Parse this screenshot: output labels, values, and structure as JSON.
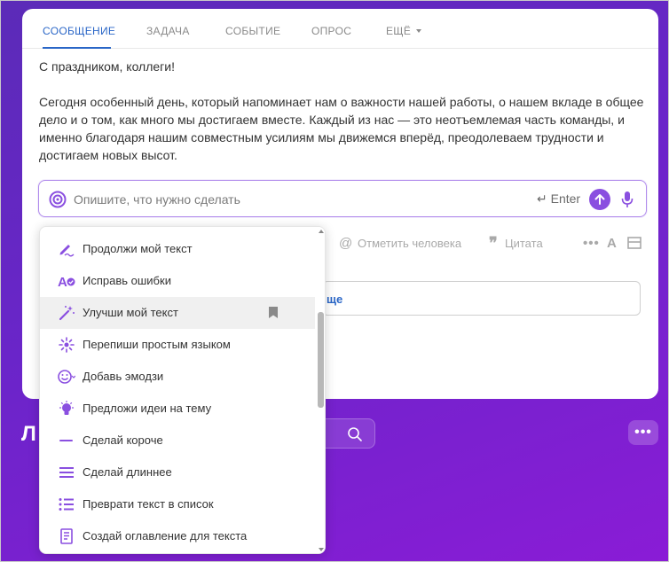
{
  "tabs": [
    {
      "label": "СООБЩЕНИЕ"
    },
    {
      "label": "ЗАДАЧА"
    },
    {
      "label": "СОБЫТИЕ"
    },
    {
      "label": "ОПРОС"
    },
    {
      "label": "ЕЩЁ"
    }
  ],
  "message": {
    "greeting": "С праздником, коллеги!",
    "body": "Сегодня особенный день, который напоминает нам о важности нашей работы, о нашем вкладе в общее дело и о том, как много мы достигаем вместе. Каждый из нас — это неотъемлемая часть команды, и именно благодаря нашим совместным усилиям мы движемся вперёд, преодолеваем трудности и достигаем новых высот."
  },
  "ai_input": {
    "placeholder": "Опишите, что нужно сделать",
    "enter_hint": "Enter"
  },
  "toolbar": {
    "mention_label": "Отметить человека",
    "quote_label": "Цитата",
    "format_label": "A"
  },
  "hidden_field": {
    "text_fragment": "ще"
  },
  "menu": {
    "items": [
      {
        "label": "Продолжи мой текст",
        "icon": "pen-icon"
      },
      {
        "label": "Исправь ошибки",
        "icon": "spellcheck-icon"
      },
      {
        "label": "Улучши мой текст",
        "icon": "magic-wand-icon"
      },
      {
        "label": "Перепиши простым языком",
        "icon": "sparkle-icon"
      },
      {
        "label": "Добавь эмодзи",
        "icon": "emoji-icon"
      },
      {
        "label": "Предложи идеи на тему",
        "icon": "lightbulb-icon"
      },
      {
        "label": "Сделай короче",
        "icon": "shorten-icon"
      },
      {
        "label": "Сделай длиннее",
        "icon": "lengthen-icon"
      },
      {
        "label": "Преврати текст в список",
        "icon": "list-icon"
      },
      {
        "label": "Создай оглавление для текста",
        "icon": "document-icon"
      }
    ]
  },
  "background": {
    "title_fragment": "Л"
  },
  "colors": {
    "accent": "#8a4fe0",
    "tab_active": "#2a66c7",
    "background_gradient_start": "#5b2bb8",
    "background_gradient_end": "#8a1cd6"
  }
}
